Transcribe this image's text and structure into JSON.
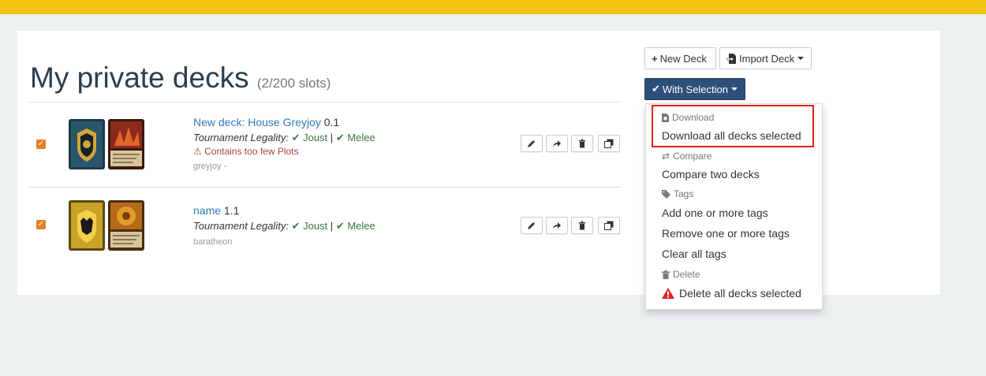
{
  "page": {
    "title": "My private decks",
    "slots": "(2/200 slots)"
  },
  "toolbar": {
    "new_deck": "New Deck",
    "import_deck": "Import Deck",
    "with_selection": "With Selection"
  },
  "decks": [
    {
      "name": "New deck: House Greyjoy",
      "version": "0.1",
      "legality_label": "Tournament Legality:",
      "formats": [
        "Joust",
        "Melee"
      ],
      "warning": "Contains too few Plots",
      "faction": "greyjoy -"
    },
    {
      "name": "name",
      "version": "1.1",
      "legality_label": "Tournament Legality:",
      "formats": [
        "Joust",
        "Melee"
      ],
      "faction": "baratheon"
    }
  ],
  "menu": {
    "download_header": "Download",
    "download_all": "Download all decks selected",
    "compare_header": "Compare",
    "compare_two": "Compare two decks",
    "tags_header": "Tags",
    "add_tags": "Add one or more tags",
    "remove_tags": "Remove one or more tags",
    "clear_tags": "Clear all tags",
    "delete_header": "Delete",
    "delete_all": "Delete all decks selected"
  },
  "colors": {
    "topbar": "#f1c40f",
    "primary": "#2c5079",
    "link": "#337ab7",
    "success": "#3c763d",
    "danger": "#a94442",
    "checkbox": "#e67e22",
    "highlight": "#e02020"
  }
}
